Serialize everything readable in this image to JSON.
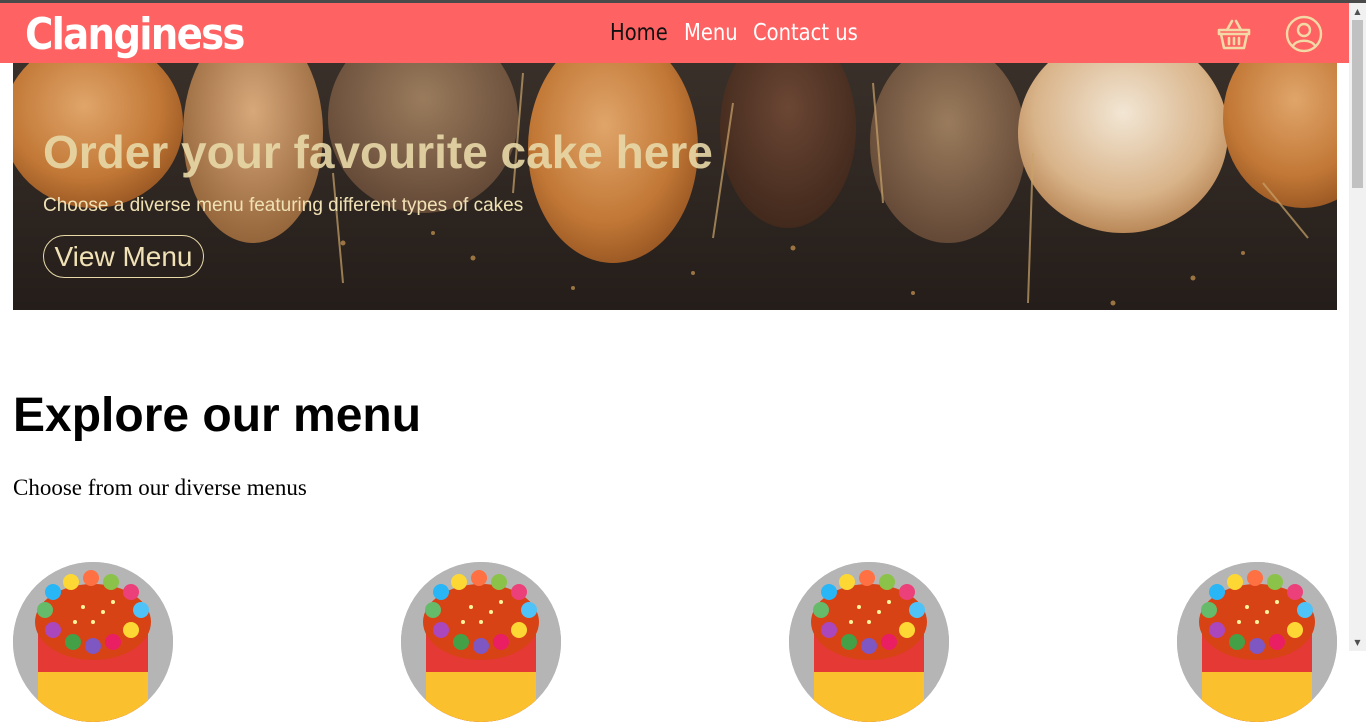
{
  "brand": {
    "name": "Clanginess"
  },
  "nav": {
    "links": [
      {
        "label": "Home",
        "active": true
      },
      {
        "label": "Menu",
        "active": false
      },
      {
        "label": "Contact us",
        "active": false
      }
    ],
    "icons": [
      "basket-icon",
      "user-icon"
    ]
  },
  "hero": {
    "title": "Order your favourite cake here",
    "subtitle": "Choose a diverse menu featuring different types of cakes",
    "button_label": "View Menu"
  },
  "menu_section": {
    "title": "Explore our menu",
    "subtitle": "Choose from our diverse menus",
    "items": [
      {
        "image": "rainbow-cake"
      },
      {
        "image": "rainbow-cake"
      },
      {
        "image": "rainbow-cake"
      },
      {
        "image": "rainbow-cake"
      }
    ]
  },
  "colors": {
    "navbar": "#ff6262",
    "hero_text": "#e8d9a8",
    "active_link": "#111111"
  }
}
